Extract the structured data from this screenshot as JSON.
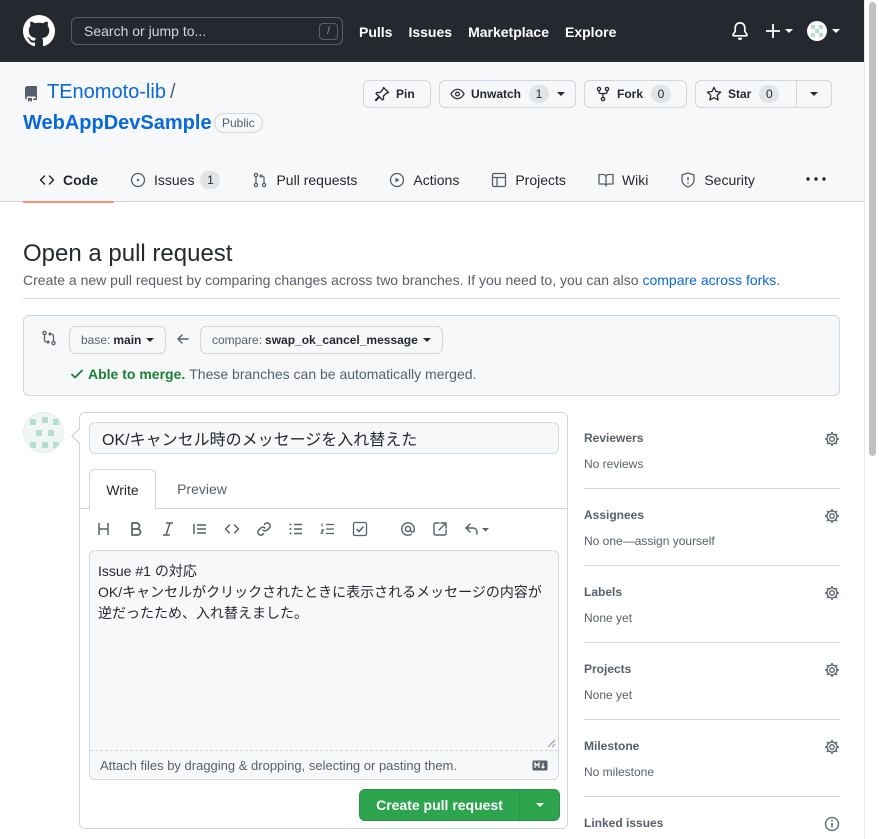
{
  "header": {
    "search_placeholder": "Search or jump to...",
    "slash_key": "/",
    "nav": [
      "Pulls",
      "Issues",
      "Marketplace",
      "Explore"
    ]
  },
  "repo": {
    "owner": "TEnomoto-lib",
    "separator": "/",
    "name": "WebAppDevSample",
    "visibility": "Public",
    "pin_label": "Pin",
    "unwatch_label": "Unwatch",
    "unwatch_count": "1",
    "fork_label": "Fork",
    "fork_count": "0",
    "star_label": "Star",
    "star_count": "0"
  },
  "tabs": [
    {
      "label": "Code",
      "icon": "code-icon",
      "selected": true
    },
    {
      "label": "Issues",
      "icon": "issue-opened-icon",
      "counter": "1"
    },
    {
      "label": "Pull requests",
      "icon": "git-pull-request-icon"
    },
    {
      "label": "Actions",
      "icon": "play-icon"
    },
    {
      "label": "Projects",
      "icon": "table-icon"
    },
    {
      "label": "Wiki",
      "icon": "book-icon"
    },
    {
      "label": "Security",
      "icon": "shield-icon"
    }
  ],
  "page": {
    "title": "Open a pull request",
    "subtitle": "Create a new pull request by comparing changes across two branches. If you need to, you can also ",
    "subtitle_link": "compare across forks",
    "subtitle_end": "."
  },
  "compare": {
    "base_prefix": "base:",
    "base_branch": "main",
    "compare_prefix": "compare:",
    "compare_branch": "swap_ok_cancel_message",
    "merge_ok": "Able to merge.",
    "merge_text": "These branches can be automatically merged."
  },
  "editor": {
    "title_value": "OK/キャンセル時のメッセージを入れ替えた",
    "tab_write": "Write",
    "tab_preview": "Preview",
    "body": "Issue #1 の対応\nOK/キャンセルがクリックされたときに表示されるメッセージの内容が\n逆だったため、入れ替えました。",
    "attach_hint": "Attach files by dragging & dropping, selecting or pasting them.",
    "submit_label": "Create pull request"
  },
  "sidebar": [
    {
      "title": "Reviewers",
      "value": "No reviews",
      "icon": "gear-icon"
    },
    {
      "title": "Assignees",
      "value": "No one—assign yourself",
      "icon": "gear-icon"
    },
    {
      "title": "Labels",
      "value": "None yet",
      "icon": "gear-icon"
    },
    {
      "title": "Projects",
      "value": "None yet",
      "icon": "gear-icon"
    },
    {
      "title": "Milestone",
      "value": "No milestone",
      "icon": "gear-icon"
    },
    {
      "title": "Linked issues",
      "value": "",
      "icon": "info-icon"
    }
  ],
  "colors": {
    "header_bg": "#24292f",
    "link": "#0969da",
    "primary_button": "#2da44e",
    "merge_ok": "#1a7f37",
    "tab_underline": "#fd8c73"
  }
}
